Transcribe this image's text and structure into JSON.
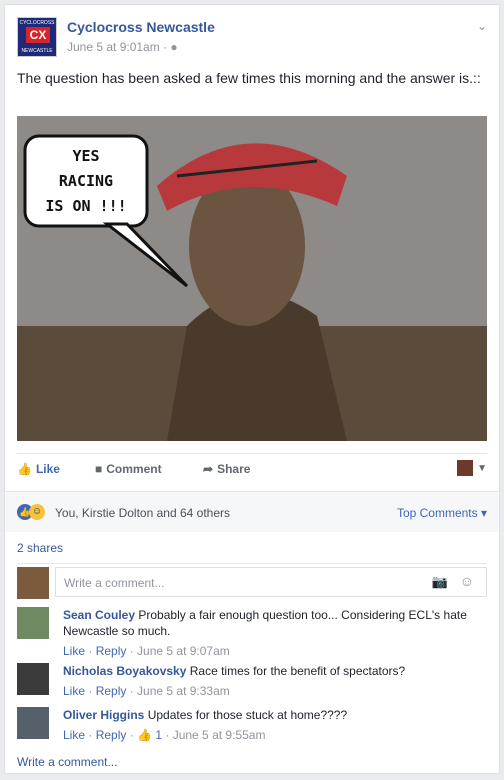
{
  "post": {
    "page_name": "Cyclocross Newcastle",
    "timestamp": "June 5 at 9:01am",
    "privacy_icon": "globe-icon",
    "menu_icon": "chevron-down-icon",
    "text": "The question has been asked a few times this morning and the answer is.::",
    "logo": {
      "top": "CYCLOCROSS",
      "mid": "CX",
      "bottom": "NEWCASTLE"
    },
    "image_bubble": {
      "line1": "YES",
      "line2": "RACING",
      "line3": "IS ON !!!"
    }
  },
  "actions": {
    "like": "Like",
    "comment": "Comment",
    "share": "Share"
  },
  "reactions": {
    "summary": "You, Kirstie Dolton and 64 others",
    "sort": "Top Comments"
  },
  "shares": "2 shares",
  "composer": {
    "placeholder": "Write a comment..."
  },
  "comments": [
    {
      "name": "Sean Couley",
      "text": "Probably a fair enough question too... Considering ECL's hate Newcastle so much.",
      "like": "Like",
      "reply": "Reply",
      "time": "June 5 at 9:07am"
    },
    {
      "name": "Nicholas Boyakovsky",
      "text": "Race times for the benefit of spectators?",
      "like": "Like",
      "reply": "Reply",
      "time": "June 5 at 9:33am"
    },
    {
      "name": "Oliver Higgins",
      "text": "Updates for those stuck at home????",
      "like": "Like",
      "reply": "Reply",
      "likes_count": "1",
      "time": "June 5 at 9:55am"
    }
  ],
  "write_comment": "Write a comment...",
  "colors": {
    "link": "#365899",
    "accent": "#4267b2",
    "muted": "#90949c"
  }
}
